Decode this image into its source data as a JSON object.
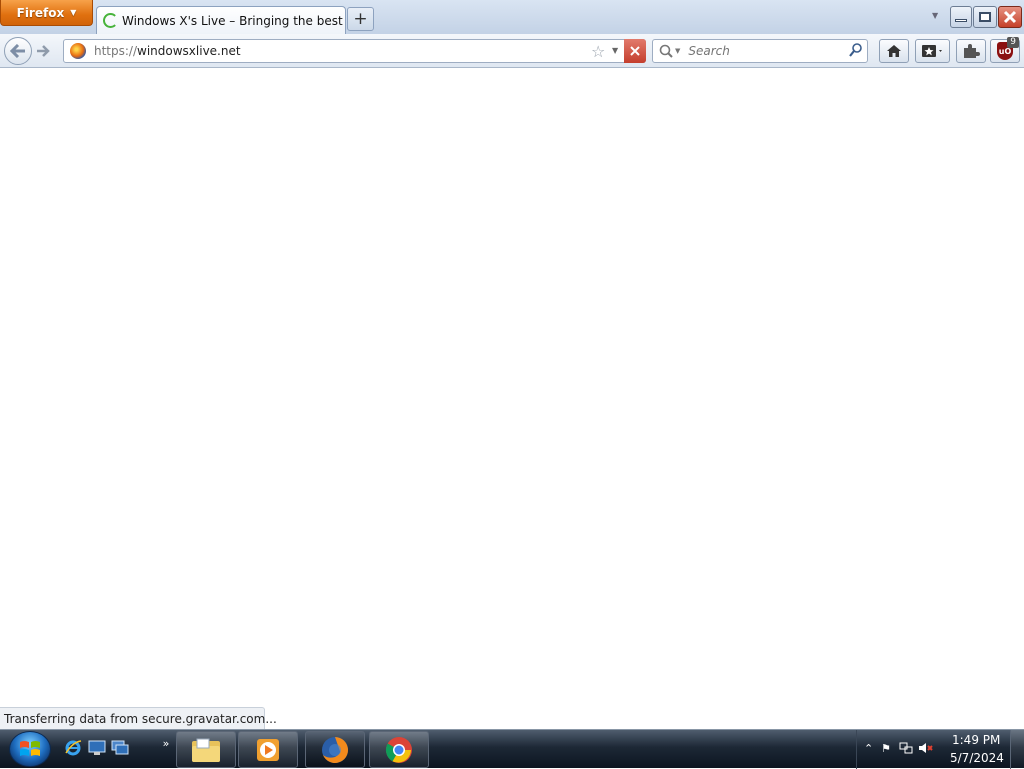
{
  "browser": {
    "menu_label": "Firefox",
    "tab": {
      "title": "Windows X's Live – Bringing the best Wi..."
    },
    "new_tab_label": "+"
  },
  "navbar": {
    "url_scheme": "https://",
    "url_host": "windowsxlive.net",
    "search_placeholder": "Search",
    "addon_badge_count": "9",
    "addon_label": "uO"
  },
  "status": {
    "text": "Transferring data from secure.gravatar.com..."
  },
  "taskbar": {
    "more_label": "»",
    "clock_time": "1:49 PM",
    "clock_date": "5/7/2024"
  },
  "colors": {
    "firefox_orange": "#e0700f",
    "close_red": "#c5412a",
    "taskbar_dark": "#1d2836"
  }
}
